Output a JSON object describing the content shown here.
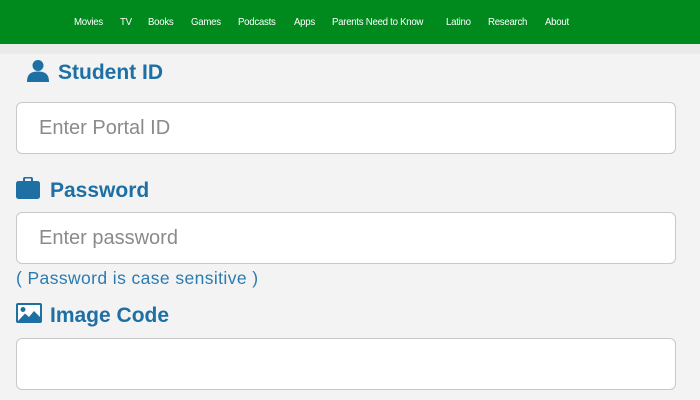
{
  "nav": {
    "items": [
      "Movies",
      "TV",
      "Books",
      "Games",
      "Podcasts",
      "Apps",
      "Parents Need to Know",
      "Latino",
      "Research",
      "About"
    ]
  },
  "form": {
    "student_id": {
      "label": "Student ID",
      "icon": "user-icon",
      "placeholder": "Enter Portal ID",
      "value": ""
    },
    "password": {
      "label": "Password",
      "icon": "briefcase-icon",
      "placeholder": "Enter password",
      "value": "",
      "hint": "( Password is case sensitive )"
    },
    "image_code": {
      "label": "Image Code",
      "icon": "picture-icon",
      "placeholder": "",
      "value": ""
    }
  },
  "colors": {
    "nav_bg": "#008a1e",
    "label_blue": "#1e6fa3",
    "hint_blue": "#2a7bb0",
    "page_bg": "#f3f3f3"
  }
}
